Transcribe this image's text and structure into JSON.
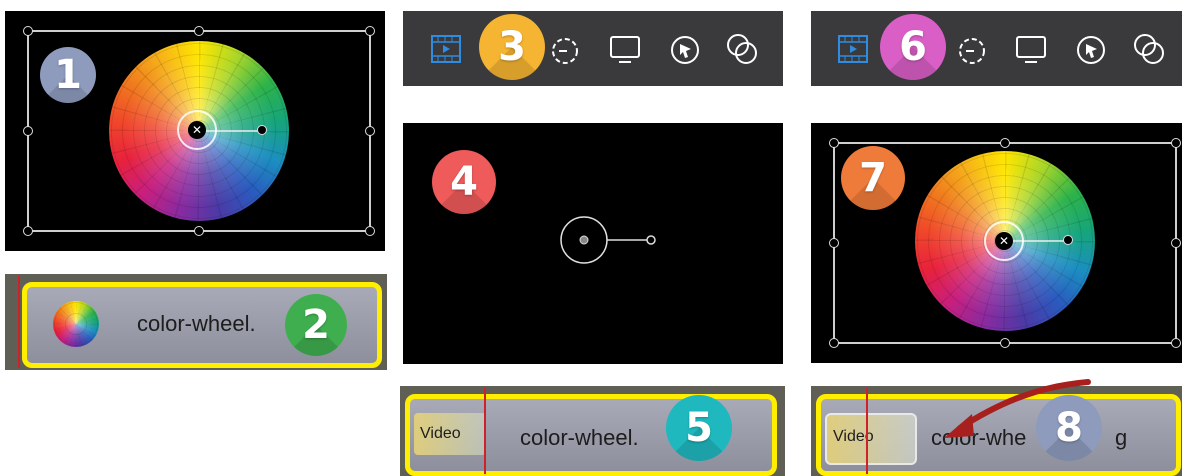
{
  "steps": [
    "1",
    "2",
    "3",
    "4",
    "5",
    "6",
    "7",
    "8"
  ],
  "clip": {
    "name_truncated": "color-wheel.",
    "name_partial": "color-whe",
    "name_tail": "g",
    "video_tag": "Video"
  },
  "toolbar_icons": [
    "film-strip-icon",
    "retime-icon",
    "display-icon",
    "cursor-icon",
    "overlap-circles-icon"
  ],
  "colors": {
    "badge_1": "#8e9bbd",
    "badge_2": "#3fae4f",
    "badge_3": "#f5b431",
    "badge_4": "#ef5a5a",
    "badge_5": "#1fb8bf",
    "badge_6": "#d95fc6",
    "badge_7": "#ef7b3a",
    "badge_8": "#8e9bbd",
    "clip_border": "#ffee00",
    "toolbar_active": "#2f8ce0",
    "arrow": "#a8201e"
  }
}
